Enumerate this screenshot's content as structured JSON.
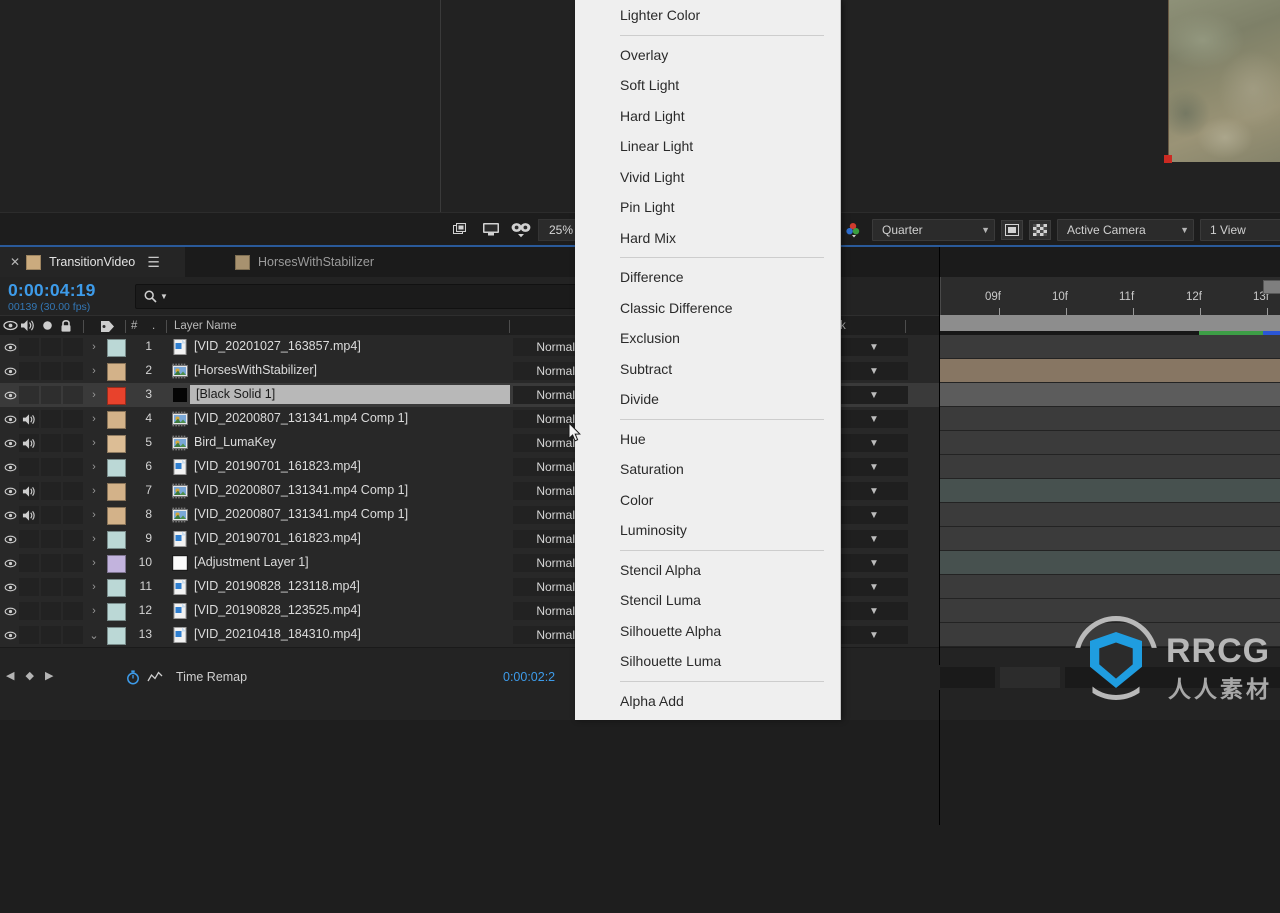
{
  "app": "Adobe After Effects",
  "viewer": {
    "zoom_label": "25%",
    "resolution": "Quarter",
    "camera": "Active Camera",
    "view_layout": "1 View",
    "icons": {
      "take_snapshot": "snapshot-icon",
      "show_channel": "monitor-icon",
      "three_d_glasses": "3d-glasses-icon",
      "color_management": "color-management-icon",
      "region_of_interest": "region-of-interest-icon",
      "transparency_grid": "transparency-grid-icon"
    }
  },
  "timeline": {
    "tabs": [
      {
        "label": "TransitionVideo",
        "active": true
      },
      {
        "label": "HorsesWithStabilizer",
        "active": false
      }
    ],
    "current_time": "0:00:04:19",
    "frame_info": "00139 (30.00 fps)",
    "search_placeholder": "",
    "columns": {
      "layer_name": "Layer Name",
      "hash": "#",
      "source_name_toggle": ".",
      "track_matte": "k"
    },
    "ruler_ticks": [
      "09f",
      "10f",
      "11f",
      "12f",
      "13f"
    ],
    "layers": [
      {
        "num": "1",
        "name": "[VID_20201027_163857.mp4]",
        "mode": "Normal",
        "color": "#bbd8d6",
        "audio": false,
        "type": "footage",
        "selected": false,
        "bar": "#3b3b3b"
      },
      {
        "num": "2",
        "name": "[HorsesWithStabilizer]",
        "mode": "Normal",
        "color": "#d3b289",
        "audio": false,
        "type": "comp",
        "selected": false,
        "bar": "#877663"
      },
      {
        "num": "3",
        "name": "[Black Solid 1]",
        "mode": "Normal",
        "color": "#e8422c",
        "audio": false,
        "type": "solid",
        "selected": true,
        "bar": "#5c5c5c"
      },
      {
        "num": "4",
        "name": "[VID_20200807_131341.mp4 Comp 1]",
        "mode": "Normal",
        "color": "#d3b289",
        "audio": true,
        "type": "comp",
        "selected": false,
        "bar": "#3b3b3b"
      },
      {
        "num": "5",
        "name": "Bird_LumaKey",
        "mode": "Normal",
        "color": "#dcbd95",
        "audio": true,
        "type": "comp",
        "selected": false,
        "bar": "#3b3b3b"
      },
      {
        "num": "6",
        "name": "[VID_20190701_161823.mp4]",
        "mode": "Normal",
        "color": "#bbd8d6",
        "audio": false,
        "type": "footage",
        "selected": false,
        "bar": "#3b3b3b"
      },
      {
        "num": "7",
        "name": "[VID_20200807_131341.mp4 Comp 1]",
        "mode": "Normal",
        "color": "#d3b289",
        "audio": true,
        "type": "comp",
        "selected": false,
        "bar": "#47514f"
      },
      {
        "num": "8",
        "name": "[VID_20200807_131341.mp4 Comp 1]",
        "mode": "Normal",
        "color": "#d3b289",
        "audio": true,
        "type": "comp",
        "selected": false,
        "bar": "#3b3b3b"
      },
      {
        "num": "9",
        "name": "[VID_20190701_161823.mp4]",
        "mode": "Normal",
        "color": "#bbd8d6",
        "audio": false,
        "type": "footage",
        "selected": false,
        "bar": "#3b3b3b"
      },
      {
        "num": "10",
        "name": "[Adjustment Layer 1]",
        "mode": "Normal",
        "color": "#c2b3dd",
        "audio": false,
        "type": "adjustment",
        "selected": false,
        "bar": "#47514f"
      },
      {
        "num": "11",
        "name": "[VID_20190828_123118.mp4]",
        "mode": "Normal",
        "color": "#bbd8d6",
        "audio": false,
        "type": "footage",
        "selected": false,
        "bar": "#3b3b3b"
      },
      {
        "num": "12",
        "name": "[VID_20190828_123525.mp4]",
        "mode": "Normal",
        "color": "#bbd8d6",
        "audio": false,
        "type": "footage",
        "selected": false,
        "bar": "#3b3b3b"
      },
      {
        "num": "13",
        "name": "[VID_20210418_184310.mp4]",
        "mode": "Normal",
        "color": "#bbd8d6",
        "audio": false,
        "type": "footage",
        "selected": false,
        "bar": "#3b3b3b"
      }
    ],
    "time_remap": {
      "label": "Time Remap",
      "value": "0:00:02:2"
    }
  },
  "blend_menu": {
    "groups": [
      [
        "Lighter Color"
      ],
      [
        "Overlay",
        "Soft Light",
        "Hard Light",
        "Linear Light",
        "Vivid Light",
        "Pin Light",
        "Hard Mix"
      ],
      [
        "Difference",
        "Classic Difference",
        "Exclusion",
        "Subtract",
        "Divide"
      ],
      [
        "Hue",
        "Saturation",
        "Color",
        "Luminosity"
      ],
      [
        "Stencil Alpha",
        "Stencil Luma",
        "Silhouette Alpha",
        "Silhouette Luma"
      ],
      [
        "Alpha Add"
      ]
    ]
  },
  "watermark": {
    "title": "RRCG",
    "subtitle": "人人素材"
  },
  "colors": {
    "accent_blue": "#3d9be9",
    "panel_bg": "#232323",
    "menu_bg": "#efefef",
    "selection": "#b8b8b8",
    "render_green": "#3d9e46"
  }
}
